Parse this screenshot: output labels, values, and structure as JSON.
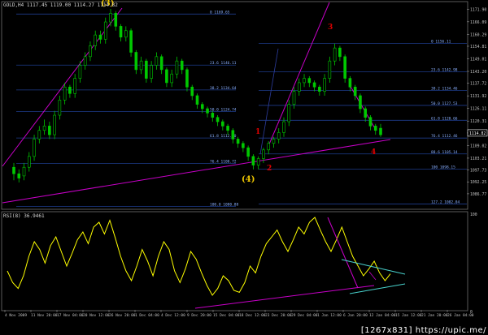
{
  "header": {
    "symbol_line": "GOLD,H4  1117.45  1119.00  1114.27  1114.82",
    "rsi_line": "RSI(8) 36.9461"
  },
  "watermark": "[1267x831] https://upic.me/",
  "colors": {
    "background": "#000000",
    "bull_candle": "#00c800",
    "bear_candle": "#00c800",
    "rsi_line": "#ffff00",
    "fib_line": "#1e3c8c",
    "trend_line": "#c800c8",
    "channel_line": "#48d1cc",
    "wave_label_yellow": "#f0c800",
    "wave_label_red": "#e00000"
  },
  "chart_data": [
    {
      "type": "candlestick",
      "title": "GOLD,H4",
      "price_axis": {
        "ticks": [
          1171.9,
          1166.09,
          1160.29,
          1154.81,
          1149.01,
          1143.2,
          1137.72,
          1131.92,
          1126.11,
          1120.31,
          1114.82,
          1109.02,
          1103.21,
          1097.73,
          1092.25,
          1086.77
        ],
        "current_price": 1114.82
      },
      "time_axis": {
        "ticks": [
          "4 Nov 2009",
          "11 Nov 20:00",
          "17 Nov 04:00",
          "20 Nov 12:00",
          "26 Nov 20:00",
          "1 Dec 04:00",
          "4 Dec 12:00",
          "9 Dec 20:00",
          "15 Dec 04:00",
          "18 Dec 12:00",
          "23 Dec 20:00",
          "29 Dec 04:00",
          "1 Jan 12:00",
          "6 Jan 20:00",
          "12 Jan 04:00",
          "15 Jan 12:00",
          "21 Jan 20:00",
          "26 Jan 04:00"
        ]
      },
      "series": {
        "close": [
          1096,
          1094,
          1099,
          1104,
          1112,
          1116,
          1118,
          1114,
          1123,
          1130,
          1136,
          1133,
          1140,
          1146,
          1150,
          1155,
          1160,
          1158,
          1166,
          1170,
          1164,
          1159,
          1162,
          1152,
          1144,
          1148,
          1140,
          1146,
          1150,
          1144,
          1138,
          1142,
          1148,
          1144,
          1136,
          1132,
          1128,
          1126,
          1124,
          1122,
          1120,
          1118,
          1116,
          1112,
          1110,
          1108,
          1104,
          1100,
          1103,
          1107,
          1110,
          1112,
          1115,
          1120,
          1128,
          1134,
          1138,
          1140,
          1138,
          1136,
          1134,
          1140,
          1148,
          1154,
          1150,
          1140,
          1136,
          1132,
          1126,
          1122,
          1118,
          1116,
          1114
        ],
        "open": [
          1099,
          1096,
          1095,
          1099,
          1104,
          1112,
          1116,
          1118,
          1114,
          1123,
          1130,
          1136,
          1133,
          1140,
          1146,
          1150,
          1155,
          1160,
          1158,
          1166,
          1170,
          1164,
          1159,
          1162,
          1152,
          1144,
          1148,
          1140,
          1146,
          1150,
          1144,
          1138,
          1142,
          1148,
          1144,
          1136,
          1132,
          1128,
          1126,
          1124,
          1122,
          1120,
          1118,
          1116,
          1112,
          1110,
          1108,
          1104,
          1100,
          1103,
          1107,
          1110,
          1112,
          1115,
          1120,
          1128,
          1134,
          1138,
          1140,
          1138,
          1136,
          1134,
          1140,
          1148,
          1154,
          1150,
          1140,
          1136,
          1132,
          1126,
          1122,
          1118,
          1117
        ],
        "high": [
          1101,
          1098,
          1101,
          1106,
          1114,
          1118,
          1121,
          1120,
          1125,
          1132,
          1138,
          1137,
          1142,
          1148,
          1152,
          1157,
          1162,
          1162,
          1168,
          1172,
          1171,
          1165,
          1164,
          1163,
          1153,
          1150,
          1149,
          1148,
          1152,
          1151,
          1145,
          1144,
          1150,
          1149,
          1145,
          1137,
          1133,
          1129,
          1127,
          1125,
          1123,
          1121,
          1119,
          1117,
          1113,
          1111,
          1109,
          1105,
          1104,
          1108,
          1111,
          1113,
          1117,
          1122,
          1130,
          1136,
          1140,
          1142,
          1141,
          1139,
          1137,
          1142,
          1150,
          1156,
          1155,
          1151,
          1141,
          1137,
          1133,
          1127,
          1123,
          1119,
          1119
        ],
        "low": [
          1093,
          1092,
          1093,
          1097,
          1102,
          1110,
          1114,
          1112,
          1112,
          1121,
          1128,
          1131,
          1131,
          1138,
          1144,
          1148,
          1153,
          1156,
          1156,
          1164,
          1162,
          1157,
          1157,
          1150,
          1142,
          1142,
          1138,
          1138,
          1144,
          1142,
          1136,
          1136,
          1140,
          1142,
          1134,
          1130,
          1126,
          1124,
          1122,
          1120,
          1118,
          1116,
          1114,
          1110,
          1108,
          1106,
          1102,
          1098,
          1098,
          1101,
          1105,
          1108,
          1110,
          1113,
          1118,
          1126,
          1132,
          1136,
          1136,
          1134,
          1132,
          1132,
          1138,
          1146,
          1148,
          1138,
          1134,
          1130,
          1124,
          1120,
          1116,
          1114,
          1113
        ]
      },
      "fib_levels_left": [
        {
          "label": "0 1169.65",
          "price": 1169.65
        },
        {
          "label": "23.6 1146.11",
          "price": 1146.11
        },
        {
          "label": "38.2 1134.64",
          "price": 1134.64
        },
        {
          "label": "50.0 1124.74",
          "price": 1124.74
        },
        {
          "label": "61.8 1112.50",
          "price": 1112.5
        },
        {
          "label": "76.4 1100.72",
          "price": 1100.72
        },
        {
          "label": "100.0 1080.88",
          "price": 1080.88
        }
      ],
      "fib_levels_right": [
        {
          "label": "0 1156.11",
          "price": 1156.11
        },
        {
          "label": "23.6 1142.98",
          "price": 1142.98
        },
        {
          "label": "38.2 1134.46",
          "price": 1134.46
        },
        {
          "label": "50.0 1127.53",
          "price": 1127.53
        },
        {
          "label": "61.8 1120.66",
          "price": 1120.66
        },
        {
          "label": "76.4 1112.46",
          "price": 1112.46
        },
        {
          "label": "88.6 1105.14",
          "price": 1105.14
        },
        {
          "label": "100 1098.15",
          "price": 1098.15
        },
        {
          "label": "127.2 1082.04",
          "price": 1082.04
        }
      ],
      "annotations": [
        {
          "text": "(3)",
          "color": "yellow"
        },
        {
          "text": "(4)",
          "color": "yellow"
        },
        {
          "text": "1",
          "color": "red"
        },
        {
          "text": "2",
          "color": "red"
        },
        {
          "text": "3",
          "color": "red"
        },
        {
          "text": "4",
          "color": "red"
        }
      ]
    },
    {
      "type": "line",
      "title": "RSI(8) 36.9461",
      "ylim": [
        0,
        100
      ],
      "y_ticks": [
        100,
        0
      ],
      "series": [
        {
          "name": "RSI(8)",
          "values": [
            40,
            28,
            22,
            35,
            55,
            70,
            62,
            48,
            66,
            75,
            60,
            45,
            58,
            72,
            80,
            68,
            85,
            90,
            78,
            92,
            74,
            55,
            40,
            30,
            45,
            62,
            50,
            35,
            55,
            70,
            62,
            40,
            28,
            42,
            60,
            52,
            38,
            25,
            15,
            22,
            35,
            30,
            20,
            18,
            28,
            45,
            38,
            55,
            68,
            75,
            82,
            70,
            60,
            72,
            85,
            78,
            90,
            95,
            82,
            70,
            60,
            72,
            85,
            70,
            55,
            45,
            35,
            42,
            50,
            38,
            30,
            37
          ]
        }
      ]
    }
  ]
}
